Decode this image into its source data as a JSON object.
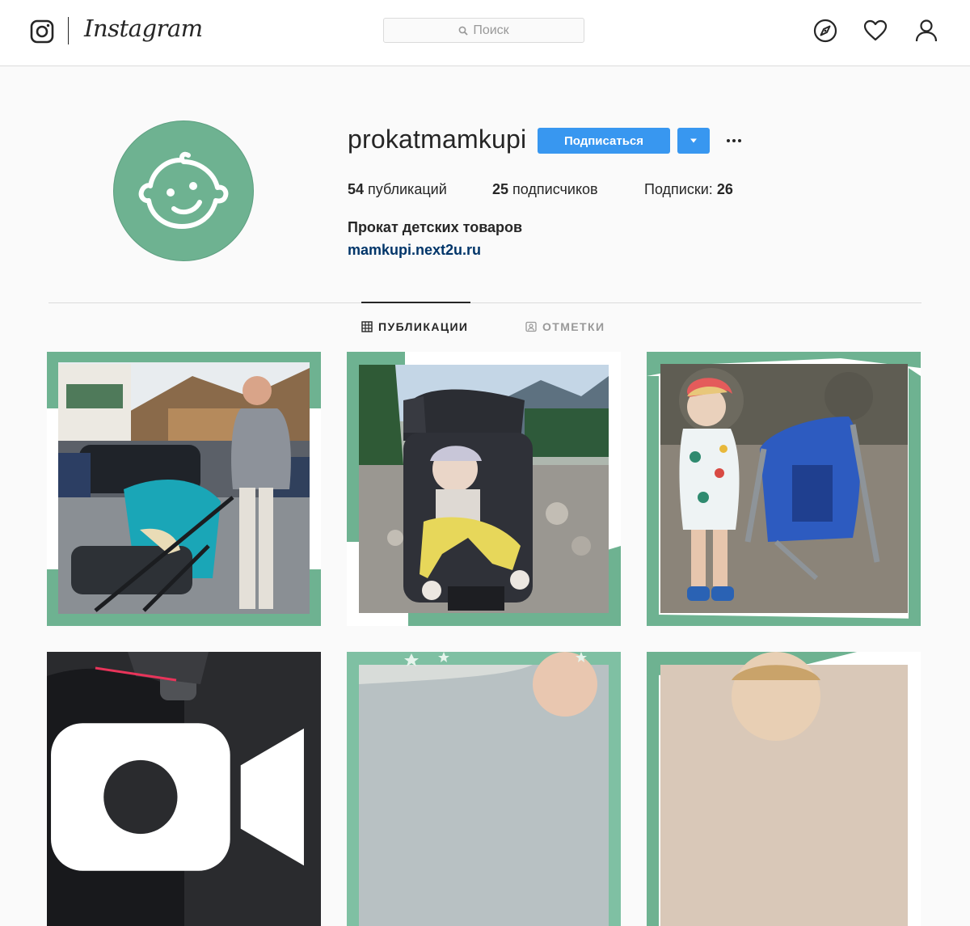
{
  "nav": {
    "brand": "Instagram",
    "search_placeholder": "Поиск"
  },
  "profile": {
    "username": "prokatmamkupi",
    "follow_label": "Подписаться",
    "stats": {
      "posts_count": "54",
      "posts_label": "публикаций",
      "followers_count": "25",
      "followers_label": "подписчиков",
      "following_label": "Подписки:",
      "following_count": "26"
    },
    "bio_name": "Прокат детских товаров",
    "bio_link": "mamkupi.next2u.ru"
  },
  "tabs": [
    {
      "label": "ПУБЛИКАЦИИ",
      "icon": "grid-icon",
      "active": true
    },
    {
      "label": "ОТМЕТКИ",
      "icon": "tagged-icon",
      "active": false
    }
  ],
  "colors": {
    "accent": "#3897f0",
    "brand_green": "#6eb291",
    "link": "#003569"
  },
  "posts": [
    {
      "content": "mother-with-blue-stroller",
      "type": "photo"
    },
    {
      "content": "baby-in-black-stroller-mountains",
      "type": "photo"
    },
    {
      "content": "child-with-blue-backpack-carrier",
      "type": "photo"
    },
    {
      "content": "car-seat",
      "type": "video"
    },
    {
      "content": "green-frame-stars",
      "type": "photo"
    },
    {
      "content": "child-portrait",
      "type": "photo"
    }
  ]
}
